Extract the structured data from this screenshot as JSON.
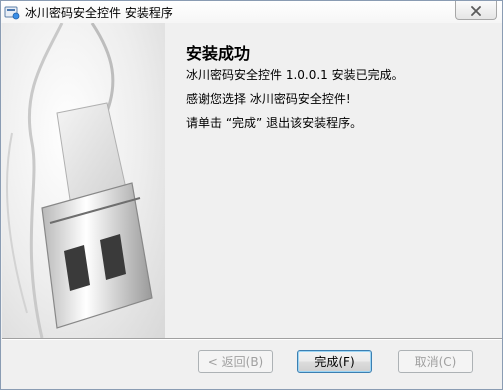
{
  "window": {
    "title": "冰川密码安全控件 安装程序",
    "app_icon": "installer-icon",
    "close_icon": "close-icon"
  },
  "content": {
    "heading": "安装成功",
    "line1": "冰川密码安全控件 1.0.0.1 安装已完成。",
    "line2": "感谢您选择 冰川密码安全控件!",
    "line3": "请单击 “完成” 退出该安装程序。"
  },
  "side_image": {
    "icon": "usb-plug-image"
  },
  "buttons": {
    "back": {
      "label": "< 返回(B)",
      "enabled": false
    },
    "finish": {
      "label": "完成(F)",
      "enabled": true,
      "default": true
    },
    "cancel": {
      "label": "取消(C)",
      "enabled": false
    }
  },
  "colors": {
    "window_bg": "#f0f0f0",
    "default_button_border": "#3c7fb1",
    "disabled_text": "#a0a0a0"
  }
}
